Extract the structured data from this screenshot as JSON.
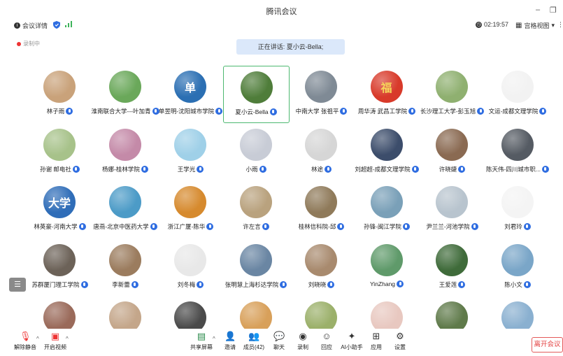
{
  "window": {
    "title": "腾讯会议",
    "minimize": "–",
    "restore": "❐"
  },
  "infobar": {
    "meeting_details": "会议详情",
    "timer": "02:19:57",
    "view_mode": "宫格视图",
    "view_caret": "▾",
    "more": "⋮"
  },
  "recording": {
    "label": "录制中"
  },
  "speaking": {
    "text": "正在讲话: 夏小云-Bella;"
  },
  "participants": [
    {
      "name": "林子雨",
      "color": "#c9a27a",
      "glyph": ""
    },
    {
      "name": "淮南联合大学---叶加青",
      "color": "#6aa85a",
      "glyph": ""
    },
    {
      "name": "单昱明-沈阳城市学院",
      "color": "#2b6fb3",
      "glyph": "单"
    },
    {
      "name": "夏小云-Bella",
      "color": "#4f7d3a",
      "glyph": ""
    },
    {
      "name": "中南大学 张祖平",
      "color": "#7f8a95",
      "glyph": ""
    },
    {
      "name": "周华涛 武昌工学院",
      "color": "#d83a2a",
      "glyph": "福"
    },
    {
      "name": "长沙理工大学-彭玉旭",
      "color": "#8fb070",
      "glyph": ""
    },
    {
      "name": "文运-成都文理学院",
      "color": "#f2f2f2",
      "glyph": ""
    },
    {
      "name": "孙谢 邮电社",
      "color": "#a7c28a",
      "glyph": ""
    },
    {
      "name": "杨娜-桂林学院",
      "color": "#c48aa8",
      "glyph": ""
    },
    {
      "name": "王学光",
      "color": "#9fd0e8",
      "glyph": ""
    },
    {
      "name": "小雨",
      "color": "#c8ccd6",
      "glyph": ""
    },
    {
      "name": "林途",
      "color": "#d6d6d6",
      "glyph": ""
    },
    {
      "name": "刘超超-成都文理学院",
      "color": "#3c4d6b",
      "glyph": ""
    },
    {
      "name": "许晓婕",
      "color": "#8a6a52",
      "glyph": ""
    },
    {
      "name": "陈天伟-四川城市职...",
      "color": "#555b63",
      "glyph": ""
    },
    {
      "name": "林英豪-河南大学",
      "color": "#2f6db8",
      "glyph": "大学"
    },
    {
      "name": "唐燕-北京中医药大学",
      "color": "#4c9bc7",
      "glyph": ""
    },
    {
      "name": "浙江广厦-陈华",
      "color": "#d68a2e",
      "glyph": ""
    },
    {
      "name": "许左言",
      "color": "#b9a27e",
      "glyph": ""
    },
    {
      "name": "桂林信科院-邱",
      "color": "#8f7a5a",
      "glyph": ""
    },
    {
      "name": "孙锋-闽江学院",
      "color": "#7aa0b8",
      "glyph": ""
    },
    {
      "name": "尹兰兰-河池学院",
      "color": "#b8c4ce",
      "glyph": ""
    },
    {
      "name": "刘君玲",
      "color": "#f4f4f4",
      "glyph": ""
    },
    {
      "name": "苏群厦门理工学院",
      "color": "#6c6258",
      "glyph": ""
    },
    {
      "name": "李新蕾",
      "color": "#9b7c5e",
      "glyph": ""
    },
    {
      "name": "刘冬梅",
      "color": "#e8e8e8",
      "glyph": ""
    },
    {
      "name": "张明慧上海杉达学院",
      "color": "#6a86a3",
      "glyph": ""
    },
    {
      "name": "刘晓晓",
      "color": "#a88a6e",
      "glyph": ""
    },
    {
      "name": "YinZhang",
      "color": "#5f9a6a",
      "glyph": ""
    },
    {
      "name": "王爱莲",
      "color": "#3f6b3a",
      "glyph": ""
    },
    {
      "name": "陈小文",
      "color": "#7aa6c8",
      "glyph": ""
    },
    {
      "name": "",
      "color": "#9a6a5a",
      "glyph": ""
    },
    {
      "name": "",
      "color": "#c4a68a",
      "glyph": ""
    },
    {
      "name": "",
      "color": "#4a4a4a",
      "glyph": ""
    },
    {
      "name": "",
      "color": "#d8a05a",
      "glyph": ""
    },
    {
      "name": "",
      "color": "#9bb06a",
      "glyph": ""
    },
    {
      "name": "",
      "color": "#e8c8c0",
      "glyph": ""
    },
    {
      "name": "",
      "color": "#5f7a4a",
      "glyph": ""
    },
    {
      "name": "",
      "color": "#8ab0d0",
      "glyph": ""
    }
  ],
  "active_participant_index": 3,
  "side_button": "☰",
  "toolbar": {
    "unmute": "解除静音",
    "start_video": "开启视频",
    "share_screen": "共享屏幕",
    "invite": "邀请",
    "members": "成员(42)",
    "chat": "聊天",
    "record": "录制",
    "replay": "回应",
    "ai_assistant": "AI小助手",
    "apps": "应用",
    "settings": "设置",
    "leave": "离开会议",
    "caret": "^"
  }
}
